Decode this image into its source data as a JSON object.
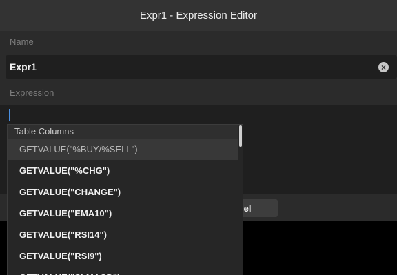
{
  "window": {
    "title": "Expr1 - Expression Editor"
  },
  "name": {
    "label": "Name",
    "value": "Expr1",
    "clear_icon": "clear-icon"
  },
  "expression": {
    "label": "Expression",
    "value": ""
  },
  "footer": {
    "cancel_label": "ncel"
  },
  "dropdown": {
    "header": "Table Columns",
    "items": [
      "GETVALUE(\"%BUY/%SELL\")",
      "GETVALUE(\"%CHG\")",
      "GETVALUE(\"CHANGE\")",
      "GETVALUE(\"EMA10\")",
      "GETVALUE(\"RSI14\")",
      "GETVALUE(\"RSI9\")",
      "GETVALUE(\"SLMACD\")"
    ],
    "highlighted_index": 0
  },
  "colors": {
    "background": "#2b2b2b",
    "field": "#1f1f1f",
    "caret": "#4a8fe0"
  }
}
